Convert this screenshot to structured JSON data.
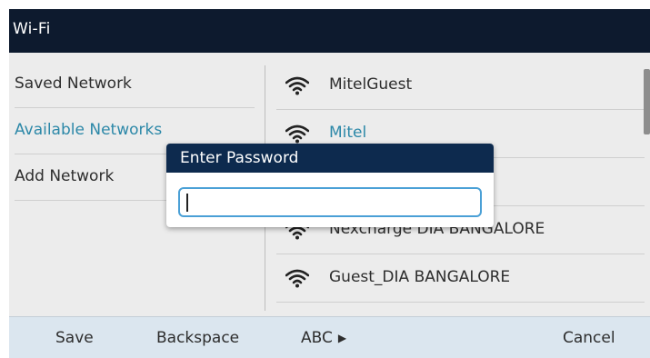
{
  "titlebar": {
    "title": "Wi-Fi"
  },
  "menu": {
    "items": [
      {
        "label": "Saved Network",
        "selected": false
      },
      {
        "label": "Available Networks",
        "selected": true
      },
      {
        "label": "Add Network",
        "selected": false
      }
    ]
  },
  "networks": {
    "items": [
      {
        "label": "MitelGuest",
        "selected": false
      },
      {
        "label": "Mitel",
        "selected": true
      },
      {
        "label": "",
        "selected": false
      },
      {
        "label": "Nexcharge DIA BANGALORE",
        "selected": false
      },
      {
        "label": "Guest_DIA BANGALORE",
        "selected": false
      }
    ]
  },
  "dialog": {
    "title": "Enter Password",
    "input_value": ""
  },
  "softkeys": {
    "save": "Save",
    "backspace": "Backspace",
    "abc": "ABC",
    "abc_arrow": "▶",
    "cancel": "Cancel"
  },
  "colors": {
    "titlebar_bg": "#0d1a2e",
    "dialog_header_bg": "#0d2a4e",
    "selected_text": "#2c88a8",
    "softkey_bar_bg": "#dbe6ef",
    "input_border": "#4aa0d6"
  }
}
